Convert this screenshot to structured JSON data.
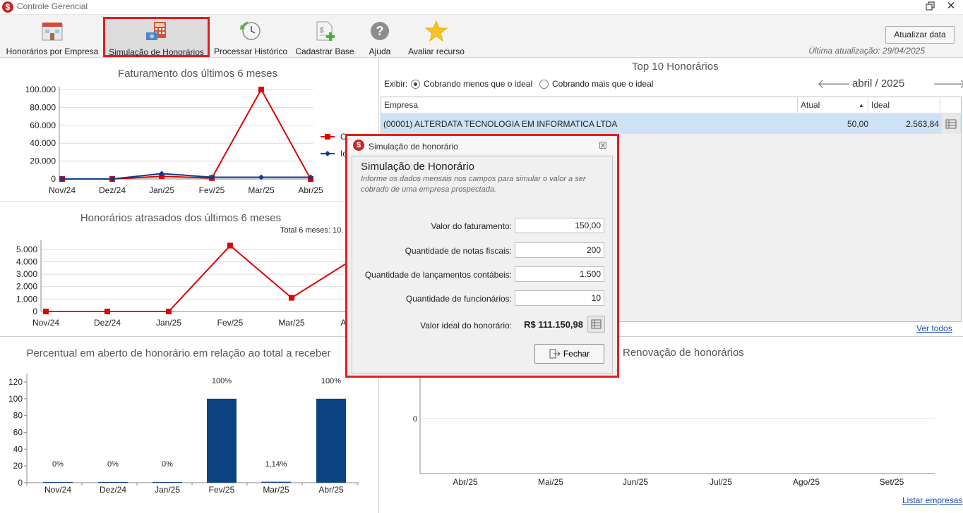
{
  "window": {
    "title": "Controle Gerencial",
    "app_icon": "$"
  },
  "toolbar": {
    "buttons": [
      {
        "label": "Honorários por Empresa",
        "icon": "building-icon"
      },
      {
        "label": "Simulação de Honorários",
        "icon": "calculator-icon"
      },
      {
        "label": "Processar Histórico",
        "icon": "history-clock-icon"
      },
      {
        "label": "Cadastrar Base",
        "icon": "add-document-icon"
      },
      {
        "label": "Ajuda",
        "icon": "help-icon"
      },
      {
        "label": "Avaliar recurso",
        "icon": "star-icon"
      }
    ],
    "refresh_label": "Atualizar data",
    "last_update": "Última atualização: 29/04/2025"
  },
  "charts": {
    "faturamento": {
      "title": "Faturamento dos últimos 6 meses",
      "legend_visible": [
        "O",
        "Id"
      ]
    },
    "atrasados": {
      "title": "Honorários atrasados dos últimos 6 meses",
      "total_label": "Total 6 meses: 10."
    },
    "percentual": {
      "title": "Percentual em aberto de honorário em relação ao total a receber"
    },
    "renovacao": {
      "title": "Renovação de honorários"
    }
  },
  "chart_data": [
    {
      "type": "line",
      "title": "Faturamento dos últimos 6 meses",
      "categories": [
        "Nov/24",
        "Dez/24",
        "Jan/25",
        "Fev/25",
        "Mar/25",
        "Abr/25"
      ],
      "ylim": [
        0,
        100000
      ],
      "y_ticks": [
        "0",
        "20.000",
        "40.000",
        "60.000",
        "80.000",
        "100.000"
      ],
      "y_tick_values": [
        0,
        20000,
        40000,
        60000,
        80000,
        100000
      ],
      "series": [
        {
          "values": [
            0,
            0,
            3000,
            1000,
            100000,
            0
          ],
          "color": "#e00000",
          "marker": "square"
        },
        {
          "values": [
            0,
            0,
            6000,
            2000,
            2000,
            2000
          ],
          "color": "#0d3d8a",
          "marker": "diamond"
        }
      ],
      "grid": true
    },
    {
      "type": "line",
      "title": "Honorários atrasados dos últimos 6 meses",
      "categories": [
        "Nov/24",
        "Dez/24",
        "Jan/25",
        "Fev/25",
        "Mar/25",
        "Abr/25"
      ],
      "ylim": [
        0,
        5500
      ],
      "y_ticks": [
        "0",
        "1.000",
        "2.000",
        "3.000",
        "4.000",
        "5.000"
      ],
      "y_tick_values": [
        0,
        1000,
        2000,
        3000,
        4000,
        5000
      ],
      "series": [
        {
          "values": [
            0,
            0,
            0,
            5300,
            1100,
            4200
          ],
          "color": "#e00000",
          "marker": "square"
        }
      ],
      "grid": true
    },
    {
      "type": "bar",
      "title": "Percentual em aberto de honorário em relação ao total a receber",
      "categories": [
        "Nov/24",
        "Dez/24",
        "Jan/25",
        "Fev/25",
        "Mar/25",
        "Abr/25"
      ],
      "values": [
        0,
        0,
        0,
        100,
        1.14,
        100
      ],
      "data_labels": [
        "0%",
        "0%",
        "0%",
        "100%",
        "1,14%",
        "100%"
      ],
      "ylim": [
        0,
        120
      ],
      "y_ticks": [
        "0",
        "20",
        "40",
        "60",
        "80",
        "100",
        "120"
      ],
      "y_tick_values": [
        0,
        20,
        40,
        60,
        80,
        100,
        120
      ],
      "color": "#0d4382"
    },
    {
      "type": "bar",
      "title": "Renovação de honorários",
      "categories": [
        "Abr/25",
        "Mai/25",
        "Jun/25",
        "Jul/25",
        "Ago/25",
        "Set/25"
      ],
      "values": [
        0,
        0,
        0,
        0,
        0,
        0
      ],
      "y_ticks": [
        "0"
      ]
    }
  ],
  "top10": {
    "title": "Top 10 Honorários",
    "show_label": "Exibir:",
    "option_less": "Cobrando menos que o ideal",
    "option_more": "Cobrando mais que o ideal",
    "selected": "less",
    "month": "abril / 2025",
    "columns": {
      "empresa": "Empresa",
      "atual": "Atual",
      "ideal": "Ideal"
    },
    "rows": [
      {
        "empresa": "(00001) ALTERDATA TECNOLOGIA EM INFORMATICA LTDA",
        "atual": "50,00",
        "ideal": "2.563,84"
      }
    ],
    "see_all": "Ver todos"
  },
  "list_companies": "Listar empresas",
  "dialog": {
    "title": "Simulação de honorário",
    "heading": "Simulação de Honorário",
    "description": "Informe os dados mensais nos campos para simular o valor a ser cobrado de uma empresa prospectada.",
    "fields": [
      {
        "label": "Valor do faturamento:",
        "value": "150,00"
      },
      {
        "label": "Quantidade de notas fiscais:",
        "value": "200"
      },
      {
        "label": "Quantidade de lançamentos contábeis:",
        "value": "1.500"
      },
      {
        "label": "Quantidade de funcionários:",
        "value": "10"
      }
    ],
    "ideal_label": "Valor ideal do honorário:",
    "ideal_value": "R$ 111.150,98",
    "close_label": "Fechar"
  }
}
